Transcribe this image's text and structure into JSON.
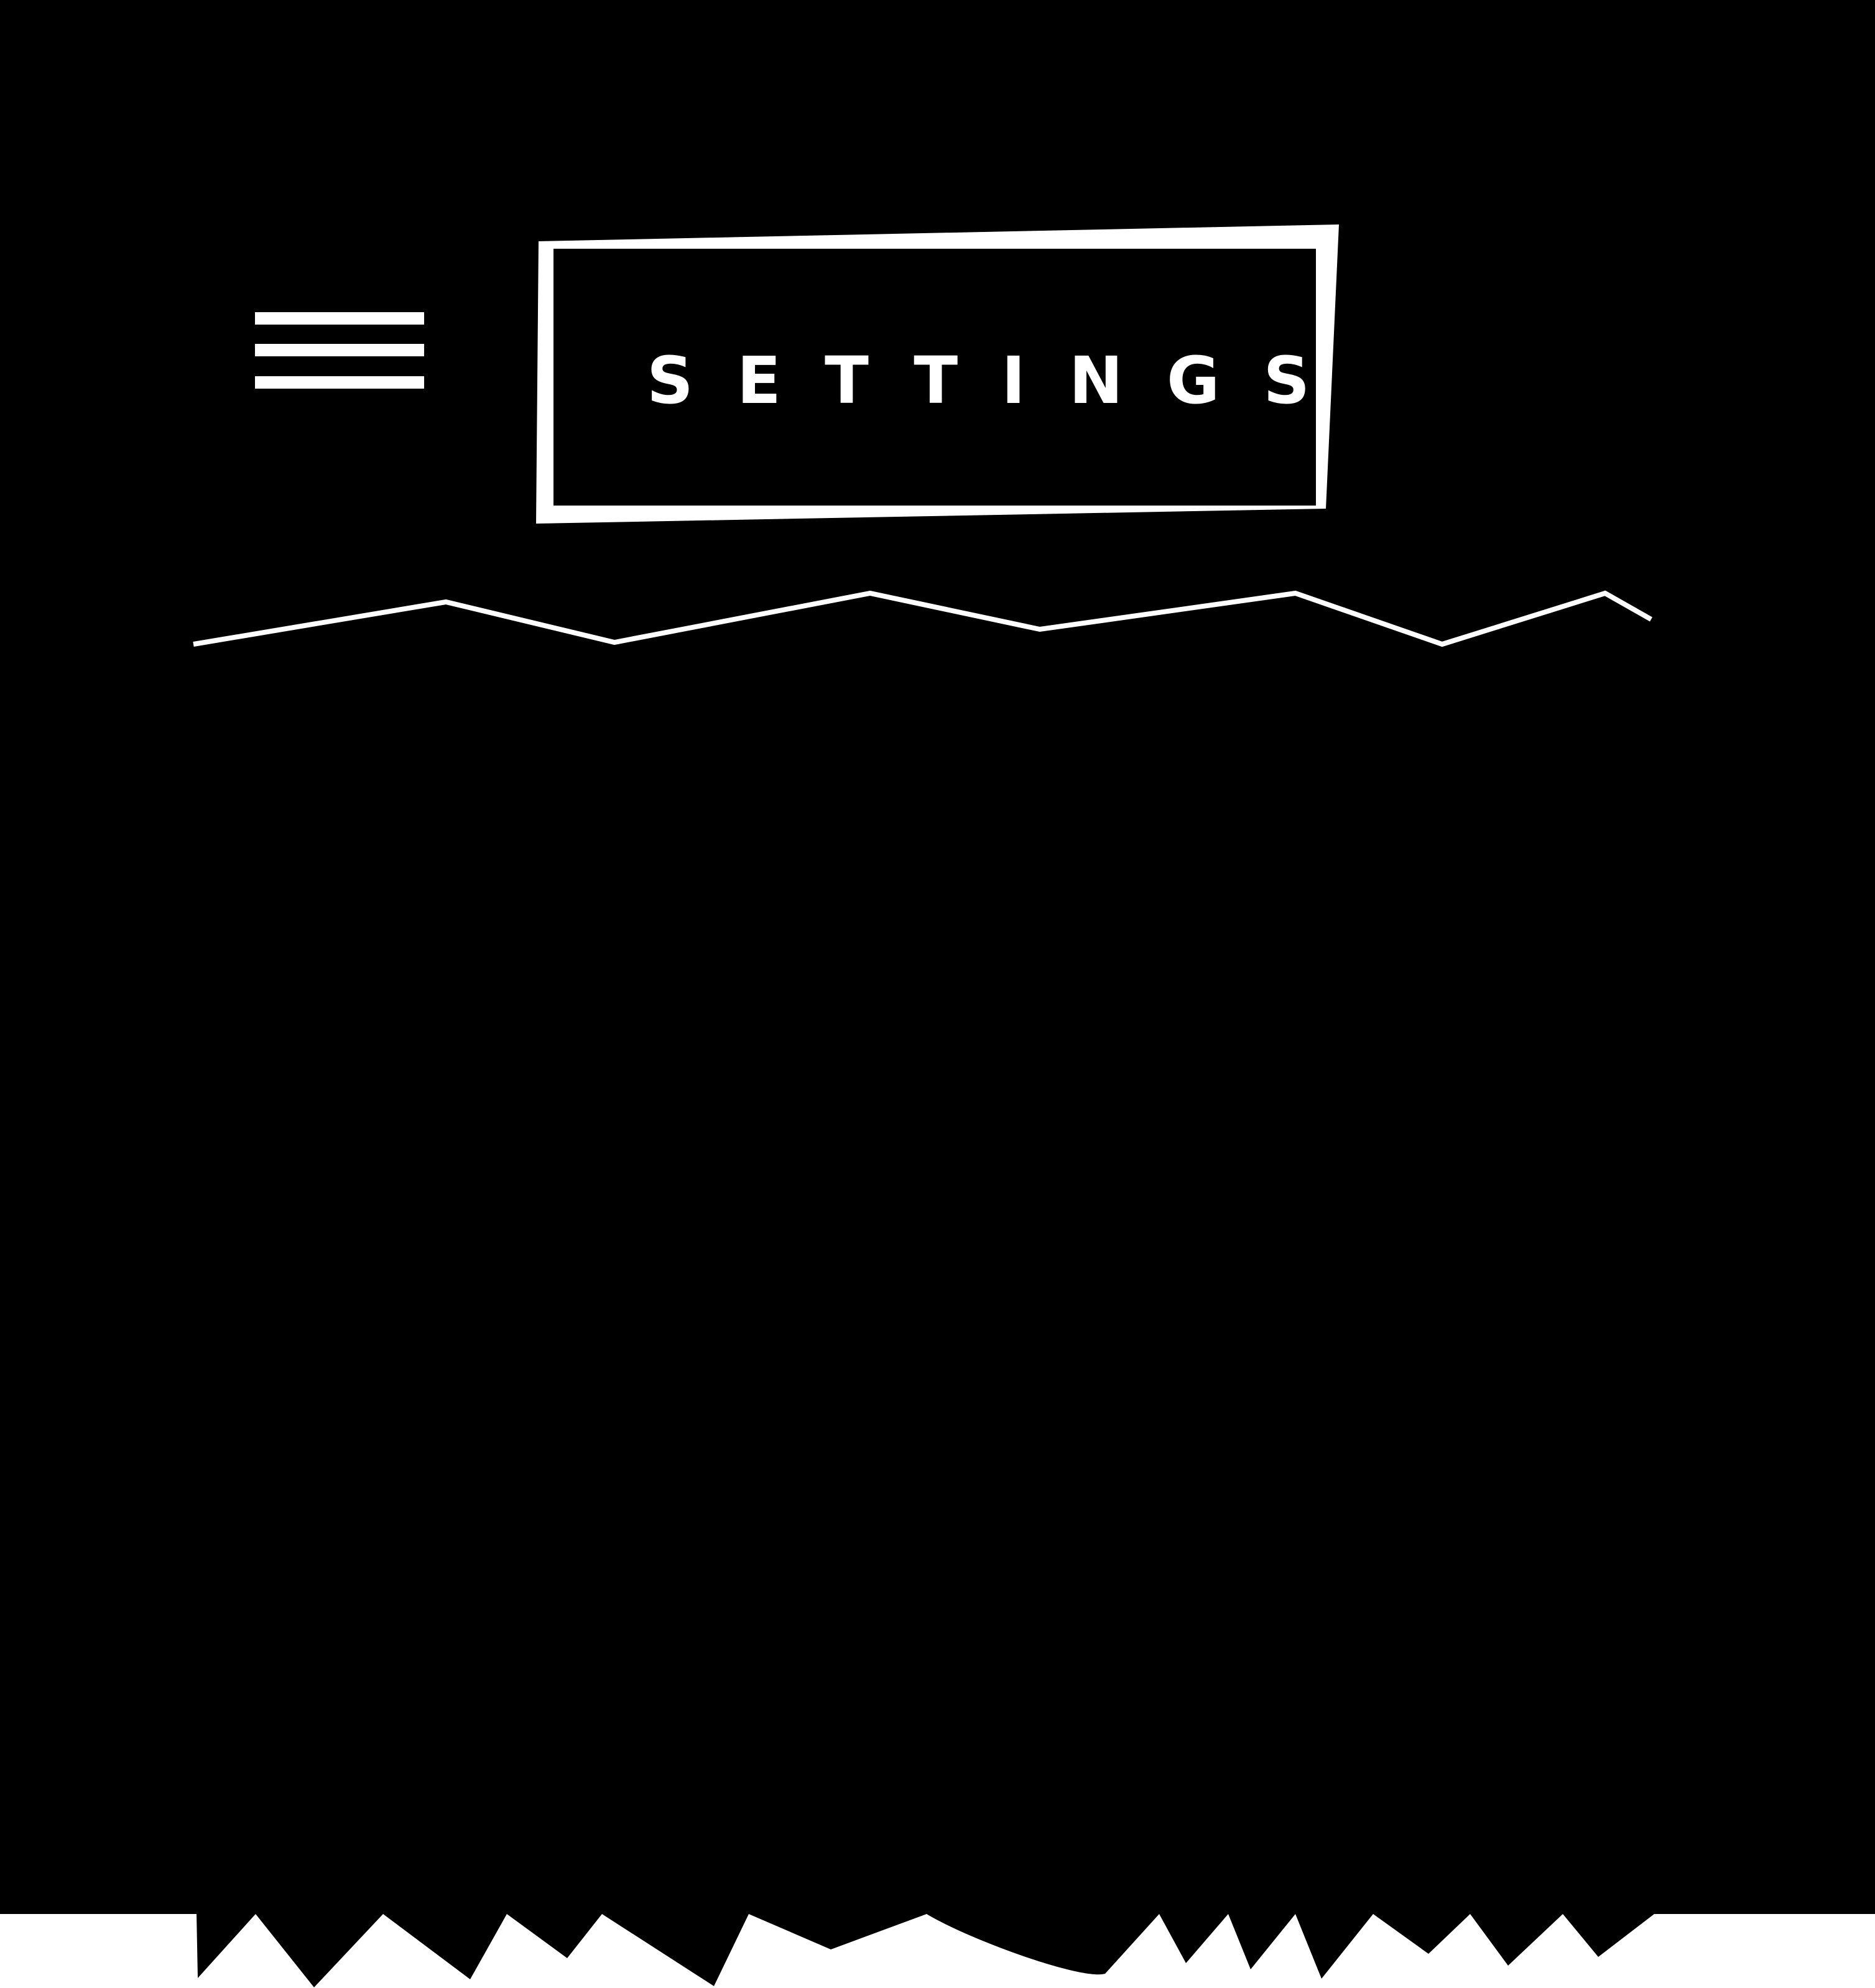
{
  "header": {
    "title": "SETTINGS",
    "menu_icon": "hamburger-menu-icon"
  },
  "colors": {
    "background": "#000000",
    "foreground": "#ffffff"
  }
}
